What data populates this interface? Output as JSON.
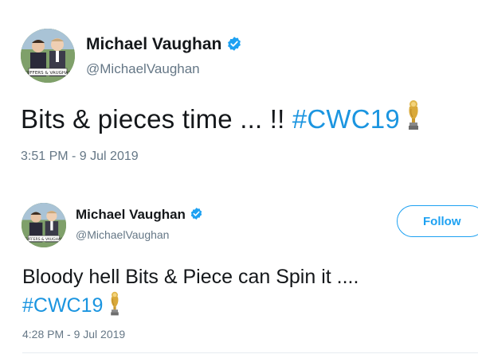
{
  "tweets": [
    {
      "display_name": "Michael Vaughan",
      "handle": "@MichaelVaughan",
      "text_plain": "Bits & pieces time ... !! ",
      "hashtag": "#CWC19",
      "timestamp": "3:51 PM - 9 Jul 2019",
      "avatar_caption": "TUFFERS & VAUGHAN"
    },
    {
      "display_name": "Michael Vaughan",
      "handle": "@MichaelVaughan",
      "text_plain": "Bloody hell Bits & Piece can Spin it ....",
      "hashtag": "#CWC19",
      "timestamp": "4:28 PM - 9 Jul 2019",
      "follow_label": "Follow",
      "avatar_caption": "TUFFERS & VAUGHAN"
    }
  ],
  "icons": {
    "verified": "verified-badge-icon",
    "trophy": "trophy-emoji-icon"
  },
  "colors": {
    "link": "#1b95e0",
    "verified": "#1da1f2",
    "secondary_text": "#657786",
    "primary_text": "#14171a"
  }
}
